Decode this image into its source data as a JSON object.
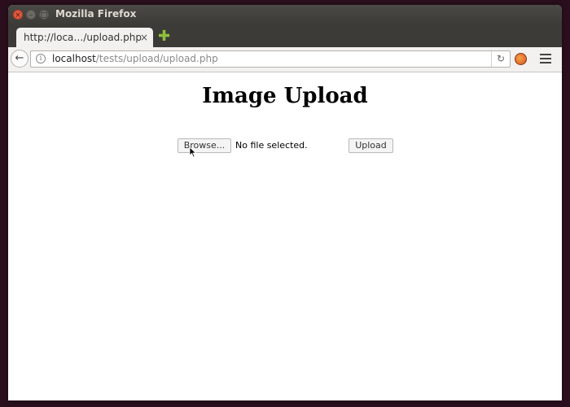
{
  "window": {
    "title": "Mozilla Firefox",
    "close_glyph": "×",
    "minimize_glyph": "–",
    "maximize_glyph": "□"
  },
  "tab": {
    "label": "http://loca…/upload.php",
    "close_glyph": "×",
    "new_tab_glyph": "✚"
  },
  "navbar": {
    "back_glyph": "←",
    "url_host": "localhost",
    "url_path": "/tests/upload/upload.php",
    "reload_glyph": "↻"
  },
  "page": {
    "title": "Image Upload",
    "browse_label": "Browse...",
    "file_status": "No file selected.",
    "upload_label": "Upload"
  },
  "colors": {
    "desktop_bg": "#2c0f1e",
    "titlebar_bg": "#3c3b37",
    "close_button": "#e2583e",
    "new_tab_plus": "#8fc03b"
  }
}
